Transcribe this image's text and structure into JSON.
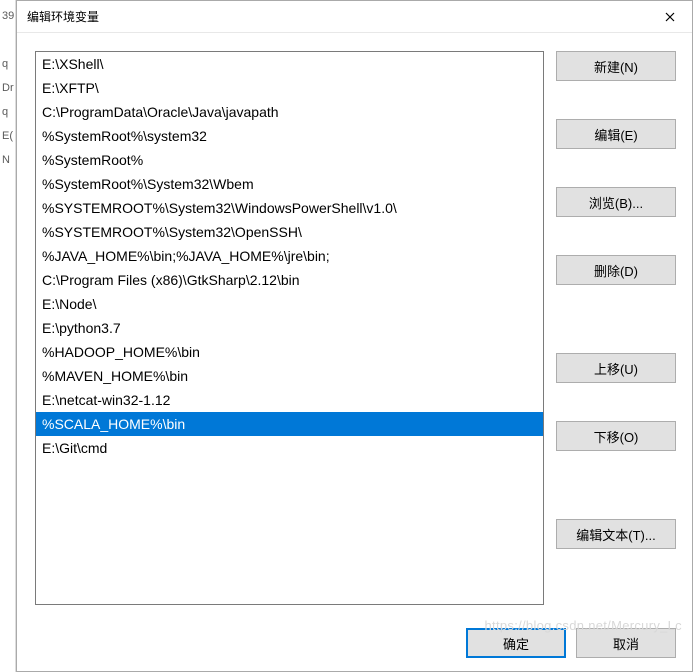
{
  "leftStrip": [
    "39",
    "",
    "q",
    "Dr",
    "q",
    "E(",
    "N"
  ],
  "titlebar": {
    "title": "编辑环境变量"
  },
  "list": {
    "items": [
      "E:\\XShell\\",
      "E:\\XFTP\\",
      "C:\\ProgramData\\Oracle\\Java\\javapath",
      "%SystemRoot%\\system32",
      "%SystemRoot%",
      "%SystemRoot%\\System32\\Wbem",
      "%SYSTEMROOT%\\System32\\WindowsPowerShell\\v1.0\\",
      "%SYSTEMROOT%\\System32\\OpenSSH\\",
      "%JAVA_HOME%\\bin;%JAVA_HOME%\\jre\\bin;",
      "C:\\Program Files (x86)\\GtkSharp\\2.12\\bin",
      "E:\\Node\\",
      "E:\\python3.7",
      "%HADOOP_HOME%\\bin",
      "%MAVEN_HOME%\\bin",
      "E:\\netcat-win32-1.12",
      "%SCALA_HOME%\\bin",
      "E:\\Git\\cmd"
    ],
    "selectedIndex": 15
  },
  "buttons": {
    "new": "新建(N)",
    "edit": "编辑(E)",
    "browse": "浏览(B)...",
    "delete": "删除(D)",
    "moveUp": "上移(U)",
    "moveDown": "下移(O)",
    "editText": "编辑文本(T)..."
  },
  "footer": {
    "ok": "确定",
    "cancel": "取消"
  },
  "watermark": "https://blog.csdn.net/Mercury_Lc"
}
